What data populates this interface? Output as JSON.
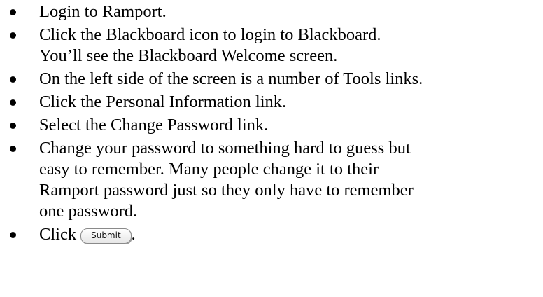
{
  "steps": [
    {
      "lines": [
        "Login to Ramport."
      ]
    },
    {
      "lines": [
        "Click the Blackboard icon to login to Blackboard.",
        "You’ll see the Blackboard Welcome screen."
      ]
    },
    {
      "lines": [
        "On the left side of the screen is a number of Tools links."
      ]
    },
    {
      "lines": [
        "Click the Personal Information link."
      ]
    },
    {
      "lines": [
        "Select the Change Password link."
      ]
    },
    {
      "lines": [
        "Change your password to something hard to guess but",
        "easy to remember.  Many people change it to their",
        "Ramport password just so they only have to remember",
        "one password."
      ]
    },
    {
      "prefix": "Click",
      "button_label": "Submit",
      "suffix": "."
    }
  ]
}
